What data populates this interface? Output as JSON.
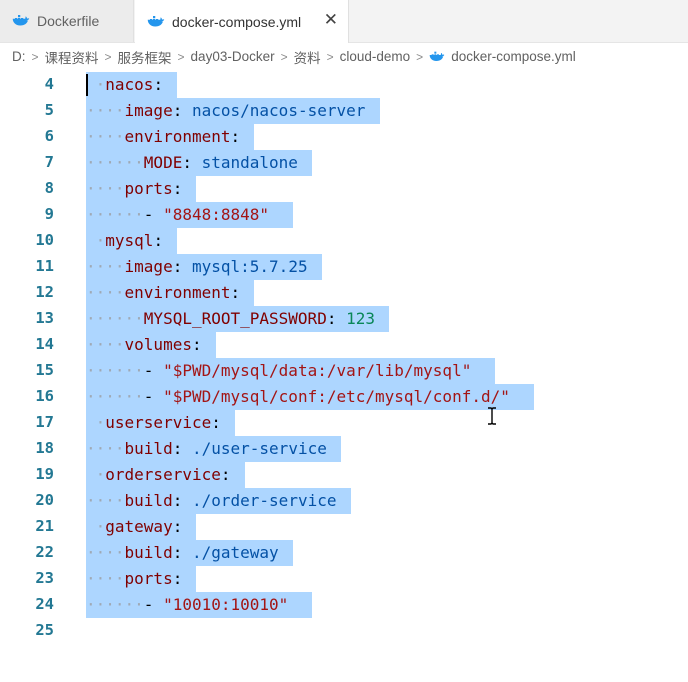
{
  "tabs": [
    {
      "label": "Dockerfile",
      "active": false
    },
    {
      "label": "docker-compose.yml",
      "active": true,
      "close_glyph": "✕"
    }
  ],
  "breadcrumb": {
    "items": [
      "D:",
      "课程资料",
      "服务框架",
      "day03-Docker",
      "资料",
      "cloud-demo",
      "docker-compose.yml"
    ],
    "separator": ">"
  },
  "editor": {
    "lines": [
      {
        "num": "4",
        "indent": 1,
        "key": "nacos",
        "colon": ":",
        "value": "",
        "value_type": ""
      },
      {
        "num": "5",
        "indent": 2,
        "key": "image",
        "colon": ":",
        "value": "nacos/nacos-server",
        "value_type": "str"
      },
      {
        "num": "6",
        "indent": 2,
        "key": "environment",
        "colon": ":",
        "value": "",
        "value_type": ""
      },
      {
        "num": "7",
        "indent": 3,
        "key": "MODE",
        "colon": ":",
        "value": "standalone",
        "value_type": "str"
      },
      {
        "num": "8",
        "indent": 2,
        "key": "ports",
        "colon": ":",
        "value": "",
        "value_type": ""
      },
      {
        "num": "9",
        "indent": 3,
        "dash": "-",
        "value": "\"8848:8848\"",
        "value_type": "qstr"
      },
      {
        "num": "10",
        "indent": 1,
        "key": "mysql",
        "colon": ":",
        "value": "",
        "value_type": ""
      },
      {
        "num": "11",
        "indent": 2,
        "key": "image",
        "colon": ":",
        "value": "mysql:5.7.25",
        "value_type": "str"
      },
      {
        "num": "12",
        "indent": 2,
        "key": "environment",
        "colon": ":",
        "value": "",
        "value_type": ""
      },
      {
        "num": "13",
        "indent": 3,
        "key": "MYSQL_ROOT_PASSWORD",
        "colon": ":",
        "value": "123",
        "value_type": "num"
      },
      {
        "num": "14",
        "indent": 2,
        "key": "volumes",
        "colon": ":",
        "value": "",
        "value_type": ""
      },
      {
        "num": "15",
        "indent": 3,
        "dash": "-",
        "value": "\"$PWD/mysql/data:/var/lib/mysql\"",
        "value_type": "qstr"
      },
      {
        "num": "16",
        "indent": 3,
        "dash": "-",
        "value": "\"$PWD/mysql/conf:/etc/mysql/conf.d/\"",
        "value_type": "qstr"
      },
      {
        "num": "17",
        "indent": 1,
        "key": "userservice",
        "colon": ":",
        "value": "",
        "value_type": ""
      },
      {
        "num": "18",
        "indent": 2,
        "key": "build",
        "colon": ":",
        "value": "./user-service",
        "value_type": "str"
      },
      {
        "num": "19",
        "indent": 1,
        "key": "orderservice",
        "colon": ":",
        "value": "",
        "value_type": ""
      },
      {
        "num": "20",
        "indent": 2,
        "key": "build",
        "colon": ":",
        "value": "./order-service",
        "value_type": "str"
      },
      {
        "num": "21",
        "indent": 1,
        "key": "gateway",
        "colon": ":",
        "value": "",
        "value_type": ""
      },
      {
        "num": "22",
        "indent": 2,
        "key": "build",
        "colon": ":",
        "value": "./gateway",
        "value_type": "str"
      },
      {
        "num": "23",
        "indent": 2,
        "key": "ports",
        "colon": ":",
        "value": "",
        "value_type": ""
      },
      {
        "num": "24",
        "indent": 3,
        "dash": "-",
        "value": "\"10010:10010\"",
        "value_type": "qstr"
      },
      {
        "num": "25",
        "indent": 0,
        "empty": true
      }
    ]
  },
  "colors": {
    "selection": "#add6ff",
    "line_number": "#237893",
    "key": "#800000",
    "string": "#0451a5",
    "quoted_string": "#a31515",
    "number": "#098658",
    "whitespace_dot": "#9fa9b5",
    "docker_whale": "#2496ed"
  },
  "icons": [
    "docker-whale-icon",
    "close-icon",
    "chevron-right-icon",
    "ibeam-cursor-icon"
  ]
}
